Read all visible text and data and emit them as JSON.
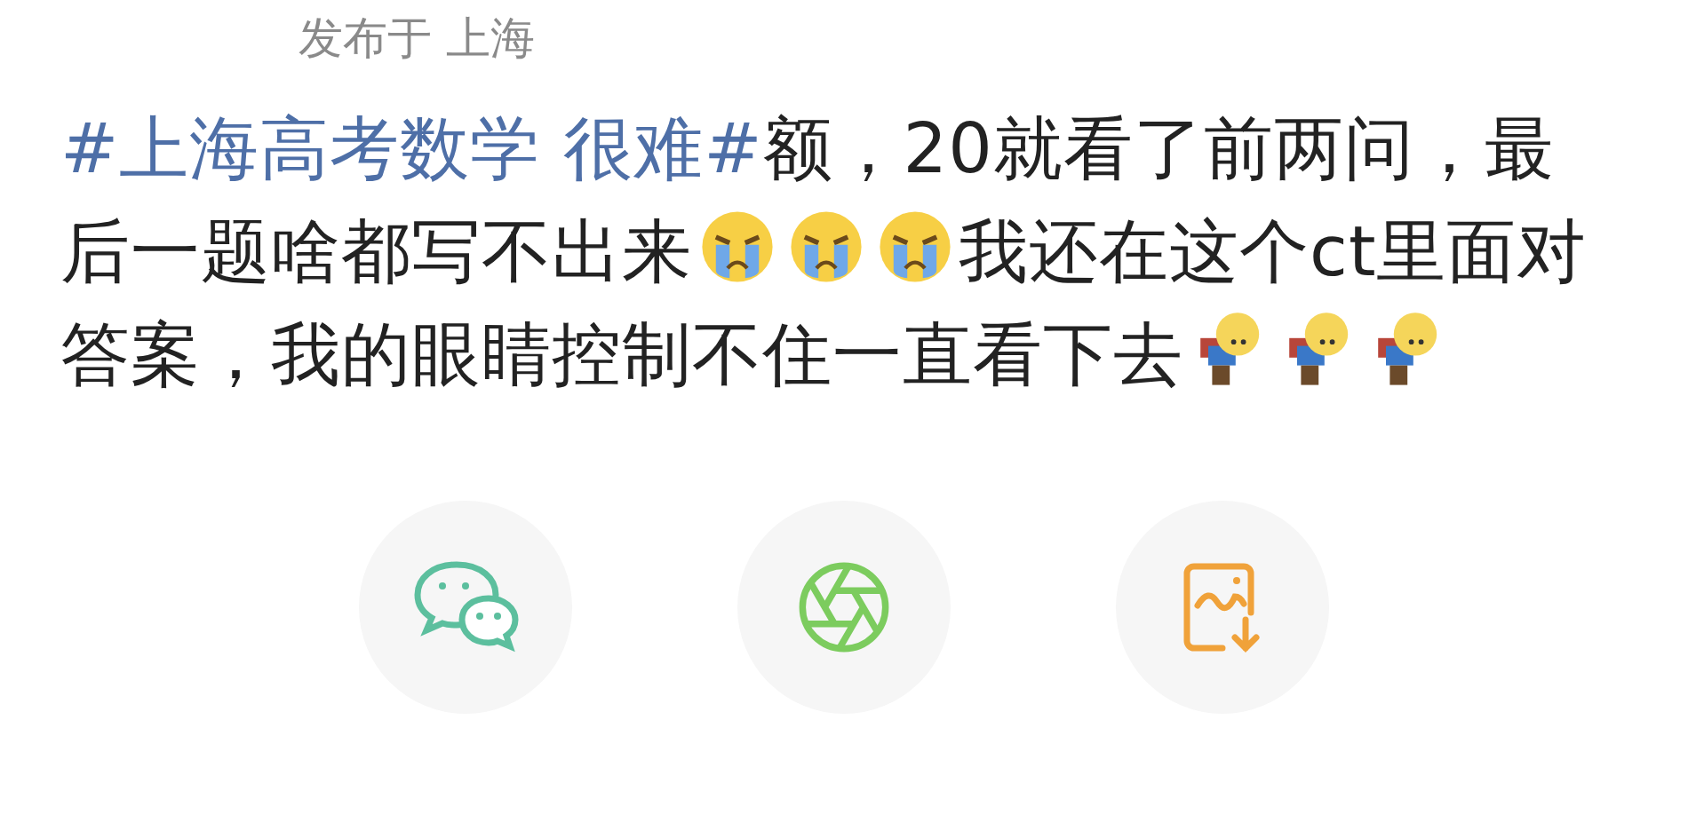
{
  "location": "发布于 上海",
  "post": {
    "segments": [
      {
        "kind": "hashtag",
        "text": "#上海高考数学 很难#"
      },
      {
        "kind": "text",
        "text": "额，20就看了前两问，最后一题啥都写不出来"
      },
      {
        "kind": "cry"
      },
      {
        "kind": "cry"
      },
      {
        "kind": "cry"
      },
      {
        "kind": "text",
        "text": "我还在这个ct里面对答案，我的眼睛控制不住一直看下去"
      },
      {
        "kind": "bow"
      },
      {
        "kind": "bow"
      },
      {
        "kind": "bow"
      }
    ]
  },
  "share_buttons": [
    {
      "kind": "wechat"
    },
    {
      "kind": "moments"
    },
    {
      "kind": "save-image"
    }
  ]
}
